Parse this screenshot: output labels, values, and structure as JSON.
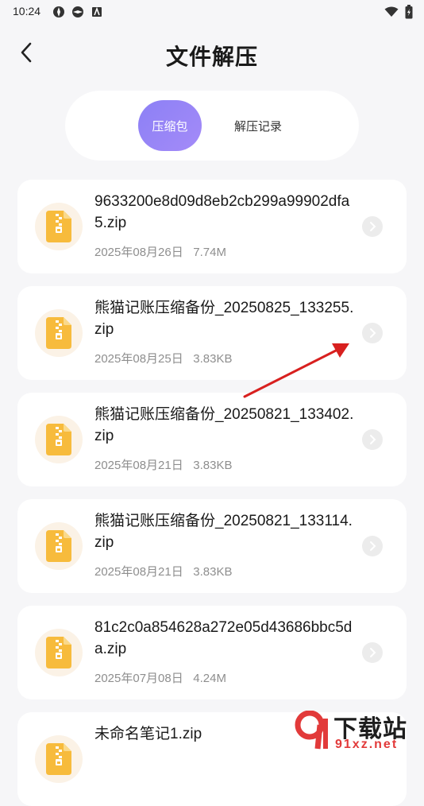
{
  "status_bar": {
    "time": "10:24"
  },
  "header": {
    "title": "文件解压"
  },
  "tabs": [
    {
      "label": "压缩包",
      "active": true
    },
    {
      "label": "解压记录",
      "active": false
    }
  ],
  "files": [
    {
      "name": "9633200e8d09d8eb2cb299a99902dfa5.zip",
      "date": "2025年08月26日",
      "size": "7.74M"
    },
    {
      "name": "熊猫记账压缩备份_20250825_133255.zip",
      "date": "2025年08月25日",
      "size": "3.83KB"
    },
    {
      "name": "熊猫记账压缩备份_20250821_133402.zip",
      "date": "2025年08月21日",
      "size": "3.83KB"
    },
    {
      "name": "熊猫记账压缩备份_20250821_133114.zip",
      "date": "2025年08月21日",
      "size": "3.83KB"
    },
    {
      "name": "81c2c0a854628a272e05d43686bbc5da.zip",
      "date": "2025年07月08日",
      "size": "4.24M"
    },
    {
      "name": "未命名笔记1.zip",
      "date": "",
      "size": ""
    }
  ],
  "watermark": {
    "brand": "下载站",
    "url": "91xz.net"
  },
  "colors": {
    "accent": "#9284f6",
    "zip_icon": "#f7bb3c",
    "annotation_arrow": "#d8201f"
  },
  "icons": {
    "back": "chevron-left-icon",
    "file": "zip-file-icon",
    "row_action": "chevron-right-icon"
  }
}
